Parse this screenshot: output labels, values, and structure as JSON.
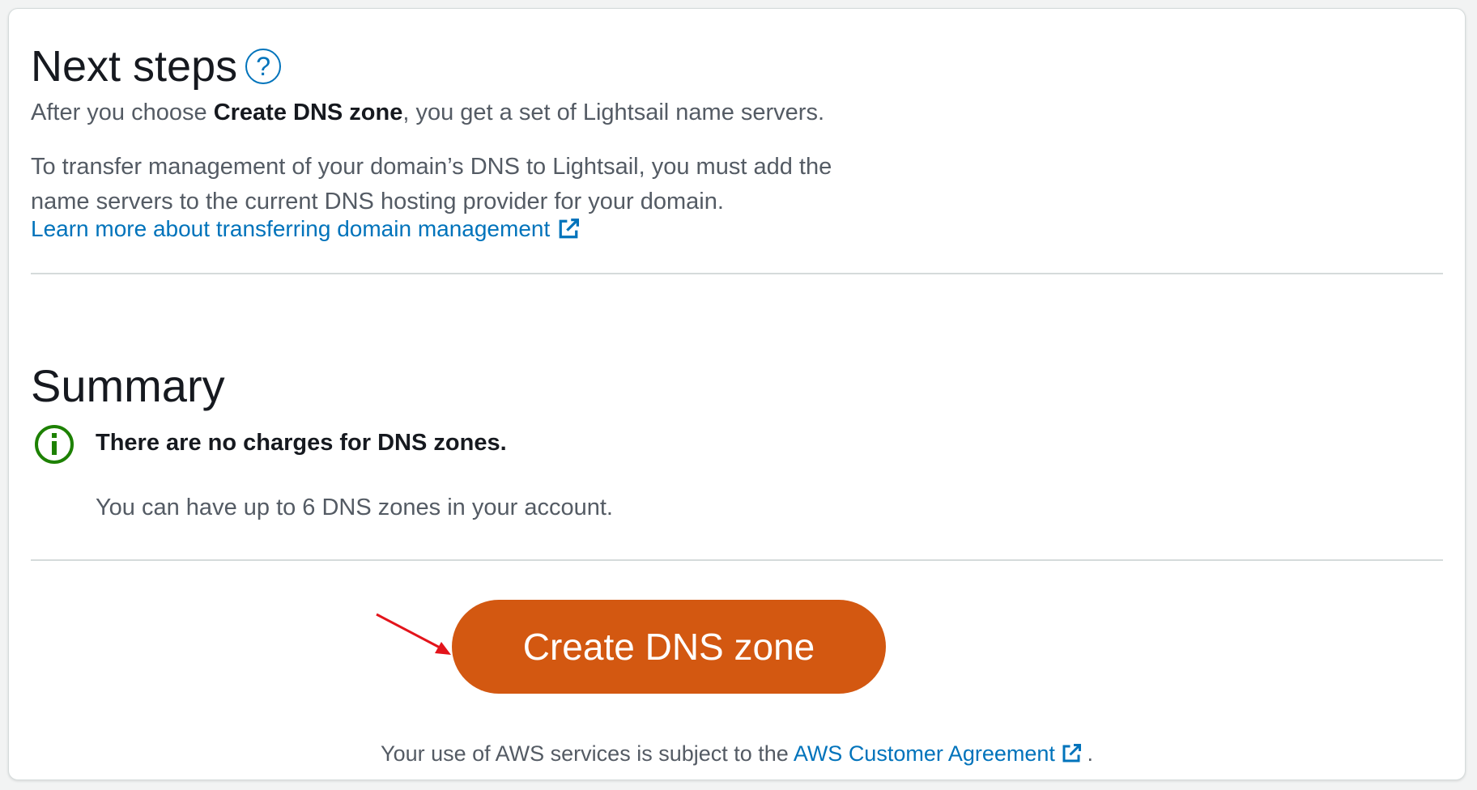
{
  "next_steps": {
    "title": "Next steps",
    "help_icon_label": "?",
    "intro_before": "After you choose ",
    "intro_bold": "Create DNS zone",
    "intro_after": ", you get a set of Lightsail name servers.",
    "transfer_line1": "To transfer management of your domain’s DNS to Lightsail, you must add the",
    "transfer_line2": "name servers to the current DNS hosting provider for your domain.",
    "learn_more_link": "Learn more about transferring domain management"
  },
  "summary": {
    "title": "Summary",
    "info_title": "There are no charges for DNS zones.",
    "info_body": "You can have up to 6 DNS zones in your account."
  },
  "actions": {
    "create_button": "Create DNS zone"
  },
  "footer": {
    "text_before": "Your use of AWS services is subject to the ",
    "agreement_link": "AWS Customer Agreement",
    "text_after": " ."
  },
  "colors": {
    "primary_button": "#d35811",
    "link": "#0073bb",
    "info_icon": "#1d8102",
    "annotation_arrow": "#e3141b"
  },
  "icons": {
    "help": "help-icon",
    "external_link": "external-link-icon",
    "info": "info-icon",
    "annotation_arrow": "arrow-icon"
  }
}
